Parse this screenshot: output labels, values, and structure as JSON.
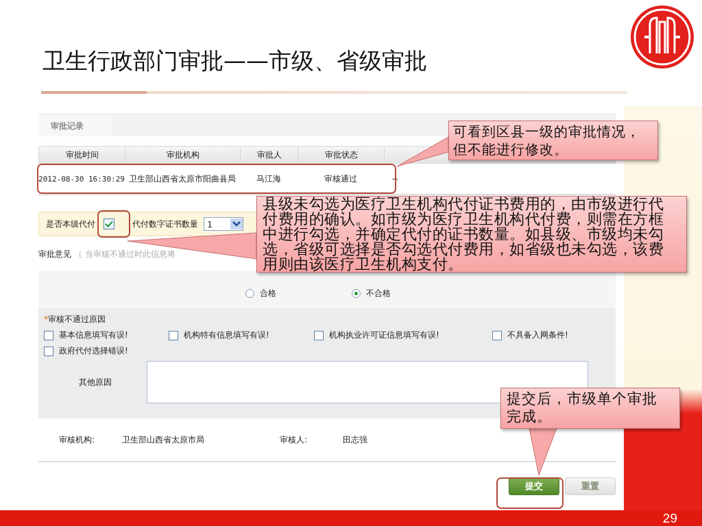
{
  "slide": {
    "title": "卫生行政部门审批——市级、省级审批",
    "page_number": "29"
  },
  "panel": {
    "tab": {
      "label": "审批记录",
      "selected": true
    },
    "table": {
      "columns": [
        "审批时间",
        "审批机构",
        "审批人",
        "审批状态"
      ],
      "rows": [
        {
          "cells": [
            "2012-08-30 16:30:29",
            "卫生部山西省太原市阳曲县局",
            "马江海",
            "审核通过",
            "--"
          ]
        }
      ]
    },
    "payment": {
      "label": "是否本级代付",
      "checked": true,
      "count_label": "代付数字证书数量",
      "count_value": "1"
    },
    "opinion": {
      "label": "审批意见",
      "hint": "（ 当审核不通过时此信息将"
    },
    "result_options": [
      {
        "label": "合格",
        "selected": false
      },
      {
        "label": "不合格",
        "selected": true
      }
    ],
    "reasons": {
      "required_mark": "*",
      "title": "审核不通过原因",
      "items": [
        {
          "label": "基本信息填写有误!",
          "checked": false
        },
        {
          "label": "机构特有信息填写有误!",
          "checked": false
        },
        {
          "label": "机构执业许可证信息填写有误!",
          "checked": false
        },
        {
          "label": "不具备入网条件!",
          "checked": false
        },
        {
          "label": "政府代付选择错误!",
          "checked": false
        }
      ]
    },
    "other_reason": {
      "label": "其他原因"
    },
    "footer": [
      {
        "label": "审核机构:",
        "value": "卫生部山西省太原市局"
      },
      {
        "label": "审核人:",
        "value": "田志强"
      }
    ],
    "buttons": [
      {
        "label": "提交",
        "kind": "primary"
      },
      {
        "label": "重置",
        "kind": "secondary"
      }
    ]
  },
  "callouts": [
    {
      "text": "可看到区县一级的审批情况，但不能进行修改。"
    },
    {
      "text": "县级未勾选为医疗卫生机构代付证书费用的，由市级进行代付费用的确认。如市级为医疗卫生机构代付费，则需在方框中进行勾选，并确定代付的证书数量。如县级、市级均未勾选，省级可选择是否勾选代付费用，如省级也未勾选，该费用则由该医疗卫生机构支付。"
    },
    {
      "text": "提交后，市级单个审批完成。"
    }
  ]
}
